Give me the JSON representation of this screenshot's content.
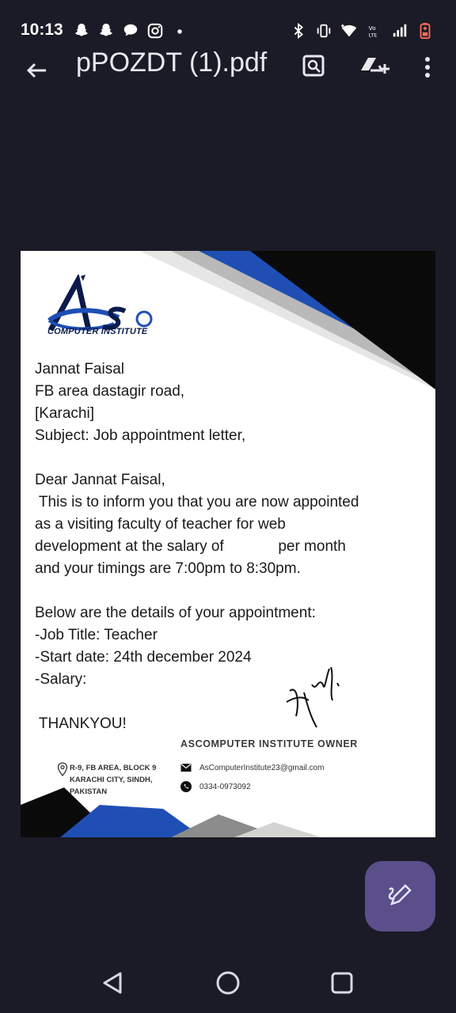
{
  "status_bar": {
    "time": "10:13"
  },
  "app_bar": {
    "title": "pPOZDT (1).pdf"
  },
  "letter": {
    "logo_text": "COMPUTER INSTITUTE",
    "lines": [
      "Jannat Faisal",
      "FB area dastagir road,",
      "[Karachi]",
      "Subject: Job appointment letter,",
      "",
      "Dear Jannat Faisal,",
      " This is to inform you that you are now appointed",
      "as a visiting faculty of teacher for web",
      "development at the salary of             per month",
      "and your timings are 7:00pm to 8:30pm.",
      "",
      "Below are the details of your appointment:",
      "-Job Title: Teacher",
      "-Start date: 24th december 2024",
      "-Salary:",
      "",
      " THANKYOU!"
    ],
    "owner_line": "ASCOMPUTER INSTITUTE OWNER",
    "address": [
      "R-9, FB AREA, BLOCK 9",
      "KARACHI CITY, SINDH,",
      "PAKISTAN"
    ],
    "email": "AsComputerInstitute23@gmail.com",
    "phone": "0334-0973092"
  },
  "colors": {
    "background": "#1a1b26",
    "accent_blue": "#1f4fb5",
    "fab": "#5a4f8a"
  },
  "icons": [
    "back-arrow-icon",
    "search-doc-icon",
    "drive-add-icon",
    "more-icon",
    "edit-pen-icon"
  ]
}
